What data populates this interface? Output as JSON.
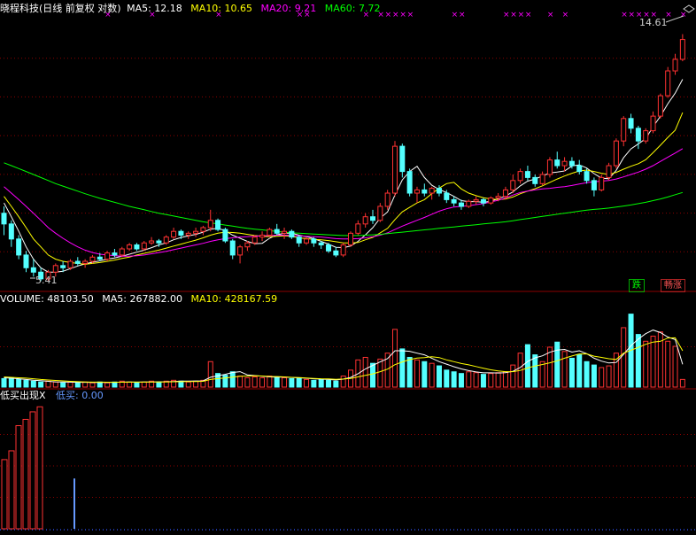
{
  "header": {
    "title": "晓程科技(日线 前复权 对数)",
    "ma5": "MA5: 12.18",
    "ma10": "MA10: 10.65",
    "ma20": "MA20: 9.21",
    "ma60": "MA60: 7.72"
  },
  "volume_header": {
    "volume": "VOLUME: 48103.50",
    "ma5": "MA5: 267882.00",
    "ma10": "MA10: 428167.59"
  },
  "indicator_header": {
    "title": "低买出现X",
    "value": "低买: 0.00"
  },
  "annotations": {
    "high": "14.61",
    "low": "5.41",
    "badge_fall": "跌",
    "badge_rise": "畅涨"
  },
  "colors": {
    "up": "#ff3232",
    "down": "#54ffff",
    "ma5": "#ffffff",
    "ma10": "#ffff00",
    "ma20": "#ff00ff",
    "ma60": "#00ff00",
    "grid": "#8b0000",
    "indicator_marker": "#6699ff"
  },
  "chart_data": {
    "type": "candlestick",
    "scale": "log",
    "ylim": [
      5.2,
      15.5
    ],
    "candles": [
      [
        7.1,
        7.3,
        6.5,
        6.8
      ],
      [
        6.8,
        6.9,
        6.2,
        6.4
      ],
      [
        6.4,
        6.5,
        5.9,
        6.0
      ],
      [
        6.0,
        6.1,
        5.6,
        5.7
      ],
      [
        5.7,
        5.9,
        5.5,
        5.6
      ],
      [
        5.6,
        5.7,
        5.4,
        5.45
      ],
      [
        5.45,
        5.65,
        5.41,
        5.6
      ],
      [
        5.6,
        5.8,
        5.5,
        5.75
      ],
      [
        5.75,
        5.85,
        5.6,
        5.7
      ],
      [
        5.7,
        5.9,
        5.65,
        5.85
      ],
      [
        5.85,
        5.95,
        5.75,
        5.8
      ],
      [
        5.8,
        5.9,
        5.7,
        5.85
      ],
      [
        5.85,
        6.0,
        5.8,
        5.95
      ],
      [
        5.95,
        6.05,
        5.85,
        5.9
      ],
      [
        5.9,
        6.1,
        5.85,
        6.05
      ],
      [
        6.05,
        6.15,
        5.95,
        6.0
      ],
      [
        6.0,
        6.2,
        5.95,
        6.15
      ],
      [
        6.15,
        6.3,
        6.1,
        6.25
      ],
      [
        6.25,
        6.3,
        6.1,
        6.15
      ],
      [
        6.15,
        6.35,
        6.1,
        6.3
      ],
      [
        6.3,
        6.45,
        6.25,
        6.35
      ],
      [
        6.35,
        6.4,
        6.2,
        6.3
      ],
      [
        6.3,
        6.5,
        6.25,
        6.45
      ],
      [
        6.45,
        6.7,
        6.4,
        6.6
      ],
      [
        6.6,
        6.65,
        6.4,
        6.5
      ],
      [
        6.5,
        6.6,
        6.4,
        6.55
      ],
      [
        6.55,
        6.7,
        6.45,
        6.6
      ],
      [
        6.6,
        6.75,
        6.5,
        6.7
      ],
      [
        6.7,
        7.2,
        6.6,
        6.9
      ],
      [
        6.9,
        6.95,
        6.6,
        6.65
      ],
      [
        6.65,
        6.7,
        6.3,
        6.35
      ],
      [
        6.35,
        6.4,
        5.9,
        6.0
      ],
      [
        6.0,
        6.25,
        5.8,
        6.2
      ],
      [
        6.2,
        6.35,
        6.1,
        6.3
      ],
      [
        6.3,
        6.5,
        6.25,
        6.45
      ],
      [
        6.45,
        6.6,
        6.35,
        6.5
      ],
      [
        6.5,
        6.7,
        6.45,
        6.65
      ],
      [
        6.65,
        6.8,
        6.5,
        6.55
      ],
      [
        6.55,
        6.7,
        6.4,
        6.6
      ],
      [
        6.6,
        6.65,
        6.4,
        6.45
      ],
      [
        6.45,
        6.5,
        6.2,
        6.3
      ],
      [
        6.3,
        6.45,
        6.25,
        6.4
      ],
      [
        6.4,
        6.45,
        6.2,
        6.3
      ],
      [
        6.3,
        6.35,
        6.15,
        6.25
      ],
      [
        6.25,
        6.3,
        6.05,
        6.1
      ],
      [
        6.1,
        6.2,
        5.95,
        6.0
      ],
      [
        6.0,
        6.3,
        5.95,
        6.25
      ],
      [
        6.25,
        6.6,
        6.2,
        6.55
      ],
      [
        6.55,
        6.9,
        6.5,
        6.8
      ],
      [
        6.8,
        7.1,
        6.7,
        7.0
      ],
      [
        7.0,
        7.2,
        6.8,
        6.9
      ],
      [
        6.9,
        7.4,
        6.85,
        7.3
      ],
      [
        7.3,
        7.8,
        7.2,
        7.7
      ],
      [
        7.7,
        9.5,
        7.6,
        9.3
      ],
      [
        9.3,
        9.4,
        8.2,
        8.4
      ],
      [
        8.4,
        8.5,
        7.6,
        7.7
      ],
      [
        7.7,
        7.9,
        7.4,
        7.8
      ],
      [
        7.8,
        8.0,
        7.6,
        7.7
      ],
      [
        7.7,
        7.9,
        7.5,
        7.85
      ],
      [
        7.85,
        7.95,
        7.6,
        7.7
      ],
      [
        7.7,
        7.8,
        7.4,
        7.5
      ],
      [
        7.5,
        7.6,
        7.3,
        7.4
      ],
      [
        7.4,
        7.5,
        7.2,
        7.3
      ],
      [
        7.3,
        7.5,
        7.25,
        7.45
      ],
      [
        7.45,
        7.6,
        7.35,
        7.5
      ],
      [
        7.5,
        7.55,
        7.3,
        7.4
      ],
      [
        7.4,
        7.6,
        7.35,
        7.55
      ],
      [
        7.55,
        7.7,
        7.45,
        7.6
      ],
      [
        7.6,
        7.9,
        7.5,
        7.8
      ],
      [
        7.8,
        8.3,
        7.7,
        8.1
      ],
      [
        8.1,
        8.5,
        8.0,
        8.4
      ],
      [
        8.4,
        8.6,
        8.1,
        8.2
      ],
      [
        8.2,
        8.3,
        7.9,
        8.0
      ],
      [
        8.0,
        8.4,
        7.95,
        8.3
      ],
      [
        8.3,
        8.9,
        8.2,
        8.8
      ],
      [
        8.8,
        9.1,
        8.5,
        8.6
      ],
      [
        8.6,
        8.9,
        8.4,
        8.75
      ],
      [
        8.75,
        8.9,
        8.5,
        8.6
      ],
      [
        8.6,
        8.8,
        8.3,
        8.4
      ],
      [
        8.4,
        8.5,
        8.0,
        8.1
      ],
      [
        8.1,
        8.2,
        7.6,
        7.8
      ],
      [
        7.8,
        8.3,
        7.75,
        8.2
      ],
      [
        8.2,
        8.7,
        8.1,
        8.6
      ],
      [
        8.6,
        9.6,
        8.5,
        9.5
      ],
      [
        9.5,
        10.5,
        9.3,
        10.4
      ],
      [
        10.4,
        10.6,
        9.8,
        10.0
      ],
      [
        10.0,
        10.1,
        9.2,
        9.5
      ],
      [
        9.5,
        10.0,
        9.4,
        9.9
      ],
      [
        9.9,
        10.7,
        9.8,
        10.5
      ],
      [
        10.5,
        11.5,
        10.4,
        11.4
      ],
      [
        11.4,
        12.8,
        11.3,
        12.6
      ],
      [
        12.6,
        13.5,
        12.4,
        13.2
      ],
      [
        13.2,
        14.61,
        13.1,
        14.3
      ]
    ],
    "series": [
      {
        "name": "MA5",
        "values": [
          7.4,
          7.0,
          6.6,
          6.2,
          5.9,
          5.7,
          5.6,
          5.6,
          5.62,
          5.68,
          5.74,
          5.79,
          5.83,
          5.86,
          5.9,
          5.93,
          5.97,
          6.02,
          6.07,
          6.12,
          6.18,
          6.25,
          6.3,
          6.38,
          6.44,
          6.48,
          6.52,
          6.58,
          6.66,
          6.68,
          6.62,
          6.5,
          6.42,
          6.34,
          6.28,
          6.29,
          6.42,
          6.51,
          6.55,
          6.55,
          6.5,
          6.46,
          6.41,
          6.34,
          6.27,
          6.19,
          6.18,
          6.22,
          6.34,
          6.51,
          6.7,
          6.96,
          7.14,
          7.64,
          8.12,
          8.4,
          8.58,
          8.2,
          7.95,
          7.81,
          7.72,
          7.6,
          7.47,
          7.44,
          7.44,
          7.42,
          7.45,
          7.53,
          7.61,
          7.74,
          7.93,
          8.08,
          8.15,
          8.25,
          8.35,
          8.38,
          8.42,
          8.59,
          8.63,
          8.52,
          8.33,
          8.18,
          8.16,
          8.44,
          8.88,
          9.2,
          9.39,
          9.59,
          10.06,
          10.5,
          11.04,
          11.52,
          12.18
        ]
      },
      {
        "name": "MA10",
        "values": [
          7.6,
          7.3,
          7.0,
          6.7,
          6.4,
          6.2,
          6.0,
          5.9,
          5.85,
          5.82,
          5.8,
          5.78,
          5.8,
          5.82,
          5.85,
          5.88,
          5.92,
          5.95,
          6.0,
          6.04,
          6.08,
          6.12,
          6.17,
          6.22,
          6.27,
          6.32,
          6.37,
          6.43,
          6.5,
          6.55,
          6.58,
          6.57,
          6.55,
          6.52,
          6.49,
          6.47,
          6.46,
          6.47,
          6.48,
          6.47,
          6.43,
          6.41,
          6.39,
          6.38,
          6.36,
          6.33,
          6.3,
          6.3,
          6.31,
          6.38,
          6.44,
          6.56,
          6.68,
          6.92,
          7.14,
          7.27,
          7.4,
          7.5,
          7.68,
          7.86,
          8.0,
          8.04,
          7.83,
          7.7,
          7.62,
          7.56,
          7.52,
          7.5,
          7.52,
          7.58,
          7.68,
          7.76,
          7.84,
          7.93,
          8.04,
          8.15,
          8.25,
          8.34,
          8.42,
          8.45,
          8.4,
          8.34,
          8.3,
          8.37,
          8.48,
          8.58,
          8.67,
          8.81,
          9.06,
          9.34,
          9.64,
          9.92,
          10.65
        ]
      },
      {
        "name": "MA20",
        "values": [
          7.9,
          7.7,
          7.5,
          7.3,
          7.1,
          6.9,
          6.7,
          6.55,
          6.42,
          6.3,
          6.2,
          6.12,
          6.06,
          6.02,
          6.0,
          5.98,
          5.97,
          5.97,
          5.98,
          6.0,
          6.03,
          6.06,
          6.09,
          6.13,
          6.17,
          6.21,
          6.25,
          6.29,
          6.34,
          6.38,
          6.41,
          6.43,
          6.45,
          6.46,
          6.47,
          6.48,
          6.49,
          6.5,
          6.5,
          6.49,
          6.48,
          6.47,
          6.46,
          6.45,
          6.43,
          6.41,
          6.4,
          6.4,
          6.41,
          6.43,
          6.46,
          6.5,
          6.56,
          6.65,
          6.74,
          6.82,
          6.9,
          6.98,
          7.07,
          7.16,
          7.23,
          7.28,
          7.3,
          7.32,
          7.35,
          7.38,
          7.43,
          7.48,
          7.55,
          7.64,
          7.72,
          7.76,
          7.8,
          7.83,
          7.85,
          7.88,
          7.9,
          7.94,
          7.99,
          8.03,
          8.06,
          8.08,
          8.1,
          8.15,
          8.22,
          8.3,
          8.38,
          8.48,
          8.6,
          8.75,
          8.9,
          9.05,
          9.21
        ]
      },
      {
        "name": "MA60",
        "values": [
          8.7,
          8.6,
          8.5,
          8.4,
          8.3,
          8.2,
          8.1,
          8.0,
          7.92,
          7.84,
          7.76,
          7.68,
          7.61,
          7.54,
          7.48,
          7.42,
          7.36,
          7.3,
          7.25,
          7.2,
          7.15,
          7.1,
          7.06,
          7.02,
          6.98,
          6.94,
          6.9,
          6.86,
          6.83,
          6.8,
          6.77,
          6.74,
          6.71,
          6.68,
          6.66,
          6.64,
          6.62,
          6.6,
          6.58,
          6.56,
          6.55,
          6.54,
          6.53,
          6.52,
          6.51,
          6.5,
          6.49,
          6.49,
          6.49,
          6.5,
          6.51,
          6.52,
          6.54,
          6.56,
          6.58,
          6.6,
          6.62,
          6.64,
          6.66,
          6.68,
          6.7,
          6.72,
          6.74,
          6.76,
          6.78,
          6.8,
          6.82,
          6.84,
          6.86,
          6.89,
          6.92,
          6.95,
          6.98,
          7.01,
          7.04,
          7.07,
          7.1,
          7.13,
          7.16,
          7.19,
          7.21,
          7.23,
          7.25,
          7.28,
          7.31,
          7.34,
          7.38,
          7.42,
          7.47,
          7.52,
          7.58,
          7.65,
          7.72
        ]
      }
    ],
    "volume": {
      "ylim": [
        0,
        950000
      ],
      "values": [
        100000,
        110000,
        90000,
        80000,
        70000,
        60000,
        70000,
        60000,
        50000,
        60000,
        50000,
        60000,
        50000,
        60000,
        50000,
        60000,
        70000,
        60000,
        50000,
        60000,
        70000,
        60000,
        70000,
        80000,
        70000,
        60000,
        70000,
        80000,
        300000,
        160000,
        140000,
        180000,
        130000,
        110000,
        120000,
        110000,
        130000,
        120000,
        110000,
        100000,
        110000,
        90000,
        80000,
        90000,
        80000,
        70000,
        130000,
        200000,
        320000,
        350000,
        280000,
        330000,
        400000,
        680000,
        450000,
        350000,
        320000,
        300000,
        280000,
        250000,
        200000,
        180000,
        160000,
        180000,
        170000,
        150000,
        160000,
        170000,
        180000,
        260000,
        400000,
        500000,
        380000,
        300000,
        470000,
        530000,
        420000,
        340000,
        380000,
        300000,
        260000,
        230000,
        250000,
        400000,
        700000,
        860000,
        620000,
        540000,
        600000,
        650000,
        540000,
        480000,
        90000
      ],
      "ma5": [
        110000,
        105000,
        98000,
        90000,
        80000,
        75000,
        68000,
        62000,
        60000,
        58000,
        56000,
        56000,
        55000,
        56000,
        55000,
        56000,
        58000,
        59000,
        58000,
        59000,
        61000,
        62000,
        63000,
        66000,
        70000,
        70000,
        72000,
        73000,
        116000,
        134000,
        150000,
        172000,
        182000,
        144000,
        136000,
        128000,
        120000,
        118000,
        118000,
        114000,
        110000,
        104000,
        98000,
        94000,
        90000,
        84000,
        94000,
        114000,
        158000,
        214000,
        256000,
        296000,
        336000,
        428000,
        428000,
        422000,
        400000,
        380000,
        340000,
        300000,
        270000,
        240000,
        214000,
        194000,
        178000,
        168000,
        168000,
        166000,
        170000,
        186000,
        232000,
        302000,
        344000,
        368000,
        410000,
        436000,
        444000,
        412000,
        428000,
        394000,
        340000,
        306000,
        284000,
        290000,
        386000,
        488000,
        566000,
        630000,
        672000,
        642000,
        590000,
        560000,
        267882
      ],
      "ma10": [
        120000,
        115000,
        110000,
        105000,
        98000,
        90000,
        84000,
        78000,
        73000,
        68000,
        64000,
        61000,
        58000,
        58000,
        57000,
        57000,
        57000,
        58000,
        58000,
        58000,
        59000,
        60000,
        61000,
        63000,
        64000,
        65000,
        66000,
        68000,
        90000,
        100000,
        108000,
        118000,
        126000,
        130000,
        134000,
        131000,
        125000,
        124000,
        120000,
        115000,
        112000,
        108000,
        102000,
        98000,
        96000,
        92000,
        95000,
        102000,
        120000,
        138000,
        156000,
        182000,
        212000,
        264000,
        296000,
        324000,
        342000,
        348000,
        358000,
        348000,
        320000,
        300000,
        278000,
        262000,
        242000,
        222000,
        204000,
        190000,
        182000,
        182000,
        196000,
        226000,
        248000,
        266000,
        286000,
        310000,
        340000,
        366000,
        390000,
        392000,
        364000,
        350000,
        334000,
        326000,
        400000,
        434000,
        468000,
        504000,
        530000,
        540000,
        578000,
        580000,
        428168
      ]
    },
    "indicator": {
      "ylim": [
        0,
        1
      ],
      "name": "低买",
      "values": [
        0.55,
        0.62,
        0.82,
        0.87,
        0.93,
        0.97,
        0.4
      ]
    }
  }
}
